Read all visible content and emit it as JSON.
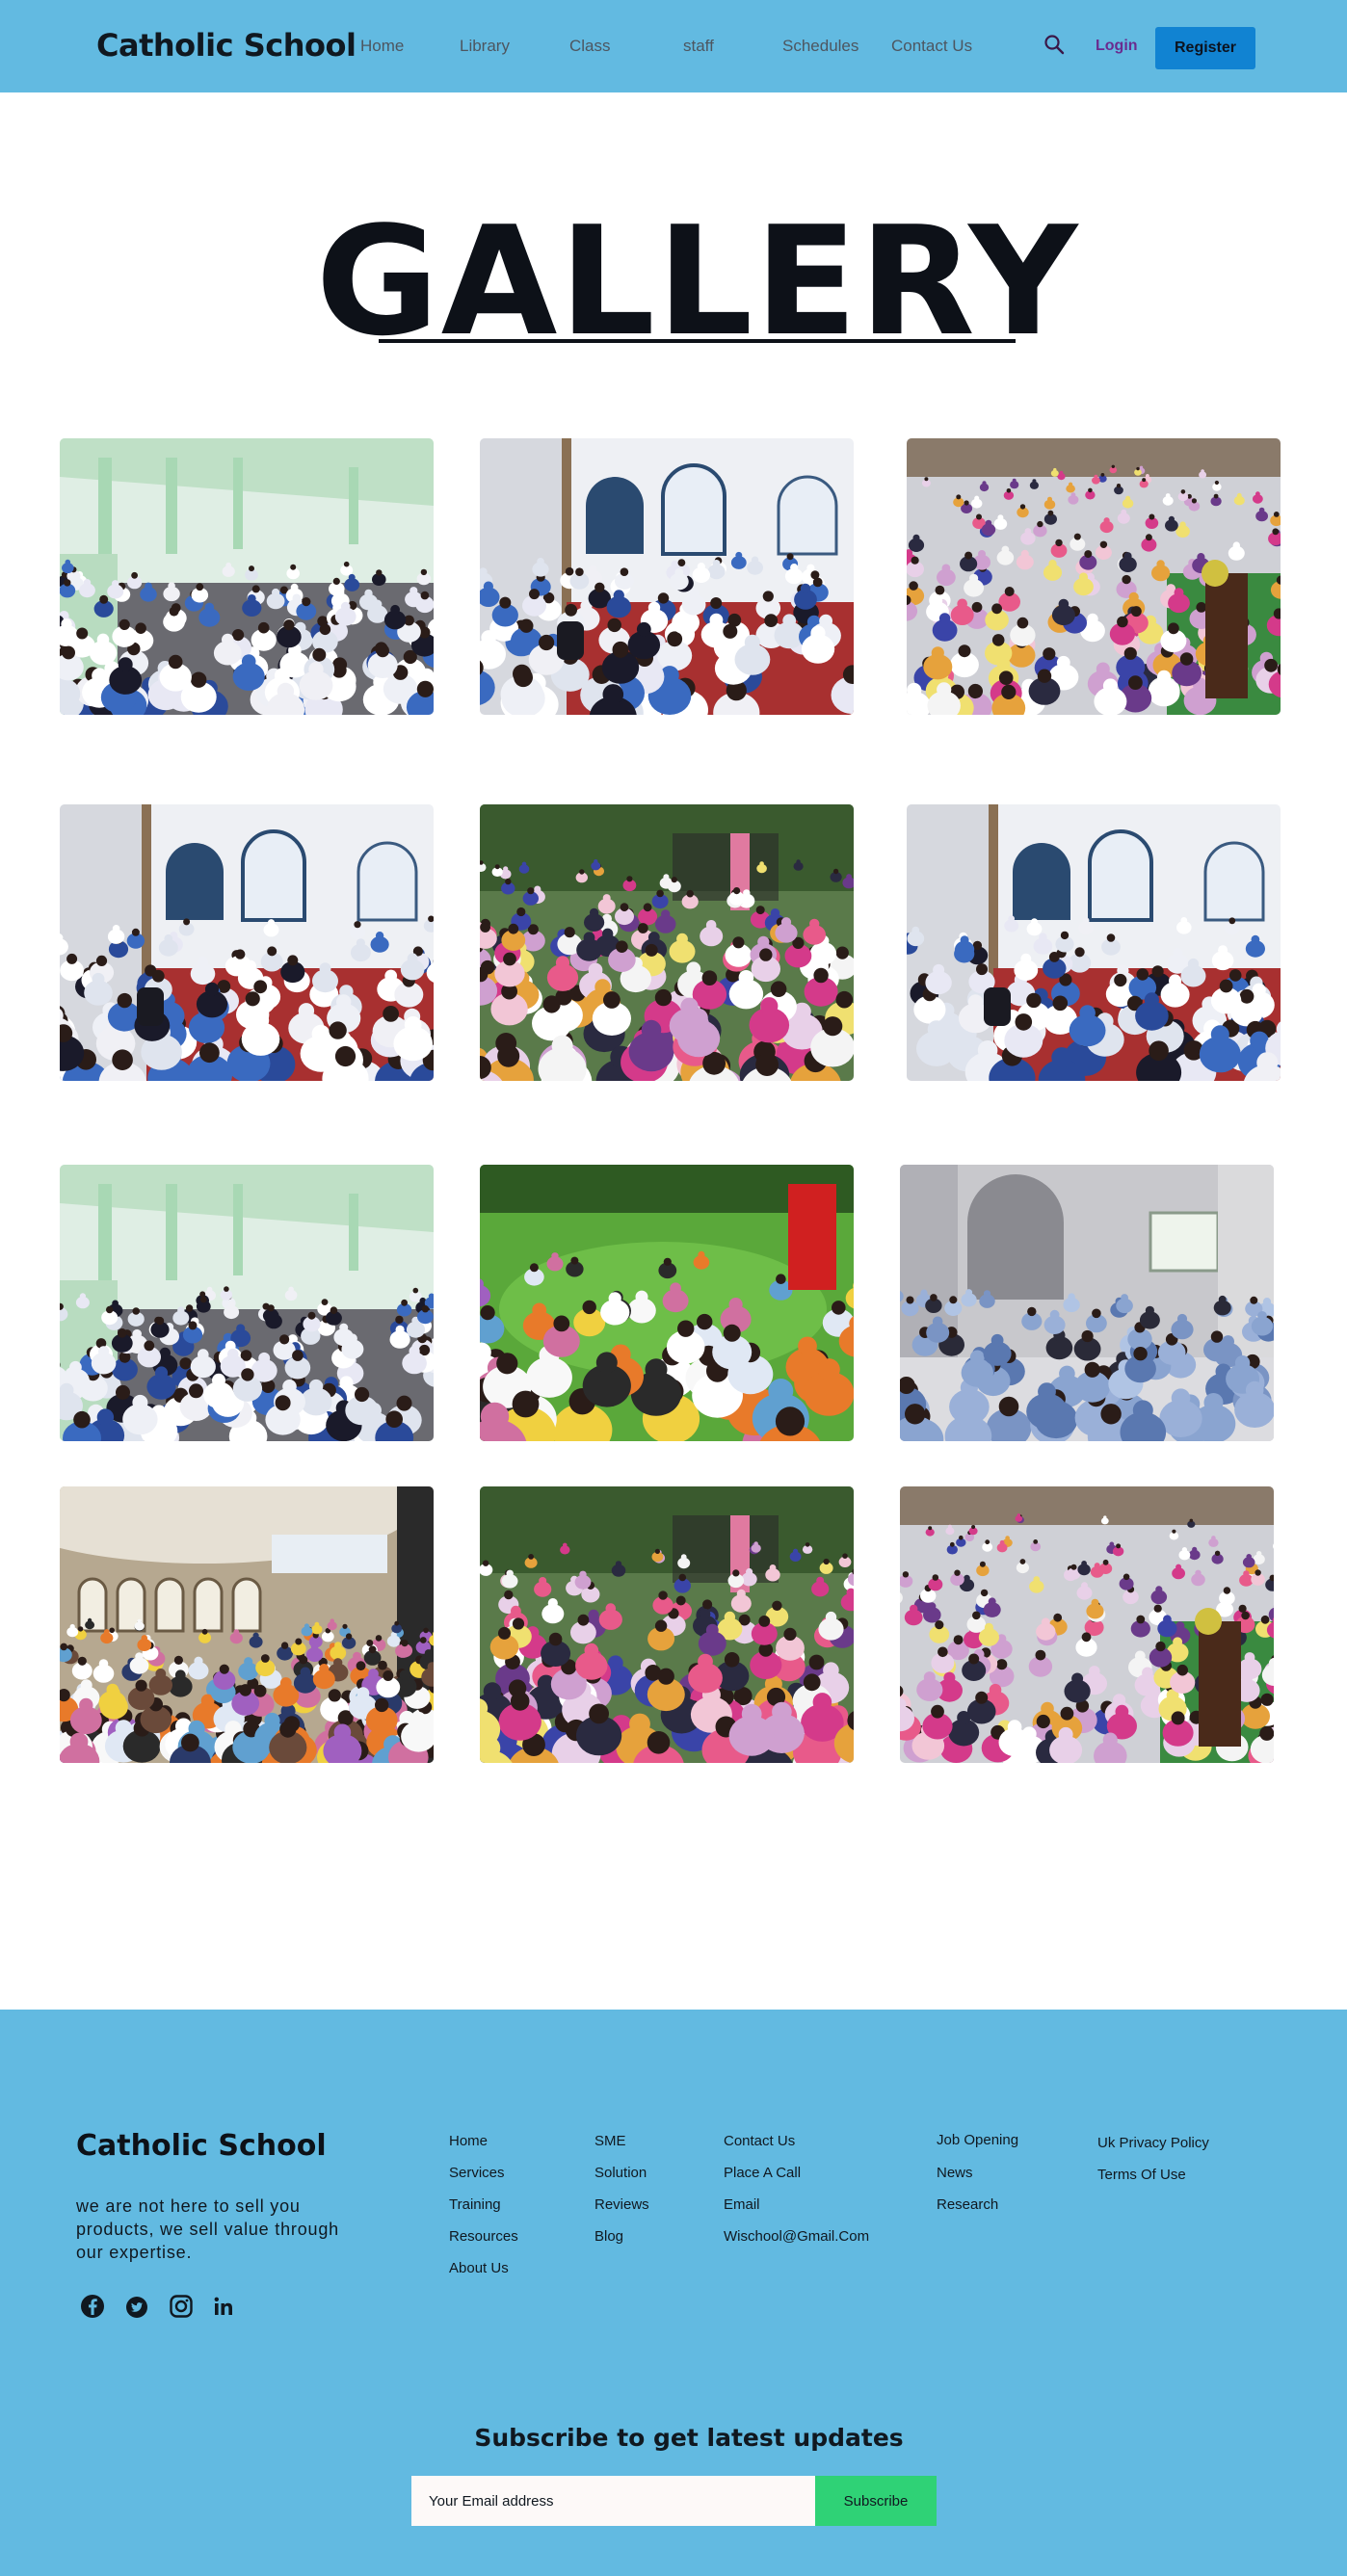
{
  "header": {
    "logo": "Catholic School",
    "nav": [
      "Home",
      "Library",
      "Class",
      "staff",
      "Schedules",
      "Contact Us"
    ],
    "search_icon": "search-icon",
    "login": "Login",
    "register": "Register"
  },
  "page_title": "GALLERY",
  "gallery": [
    {
      "scene": "hall-green-rows"
    },
    {
      "scene": "hall-white-arches"
    },
    {
      "scene": "hall-colorful-rows"
    },
    {
      "scene": "hall-white-arches"
    },
    {
      "scene": "outdoor-colorful-crowd"
    },
    {
      "scene": "hall-white-arches"
    },
    {
      "scene": "hall-green-rows"
    },
    {
      "scene": "lawn-circle"
    },
    {
      "scene": "marble-hall-uniforms"
    },
    {
      "scene": "dome-hall-crowd"
    },
    {
      "scene": "outdoor-colorful-crowd"
    },
    {
      "scene": "hall-colorful-rows"
    }
  ],
  "footer": {
    "logo": "Catholic School",
    "tagline": "we are not here to sell you products, we sell value through our expertise.",
    "social_icons": [
      "facebook-icon",
      "twitter-icon",
      "instagram-icon",
      "linkedin-icon"
    ],
    "col1": [
      "Home",
      "Services",
      "Training",
      "Resources",
      "About Us"
    ],
    "col2": [
      "SME",
      "Solution",
      "Reviews",
      "Blog"
    ],
    "col3": [
      "Contact Us",
      "Place A Call",
      "Email",
      "Wischool@Gmail.Com"
    ],
    "col4": [
      "Job Opening",
      "News",
      "Research"
    ],
    "col5": [
      "Uk Privacy Policy",
      "Terms Of Use"
    ],
    "subscribe_title": "Subscribe to get latest updates",
    "email_placeholder": "Your Email address",
    "subscribe_button": "Subscribe"
  },
  "colors": {
    "header_bg": "#62bae1",
    "register_bg": "#1183d2",
    "login_text": "#6a2b8f",
    "subscribe_bg": "#2fd276"
  }
}
